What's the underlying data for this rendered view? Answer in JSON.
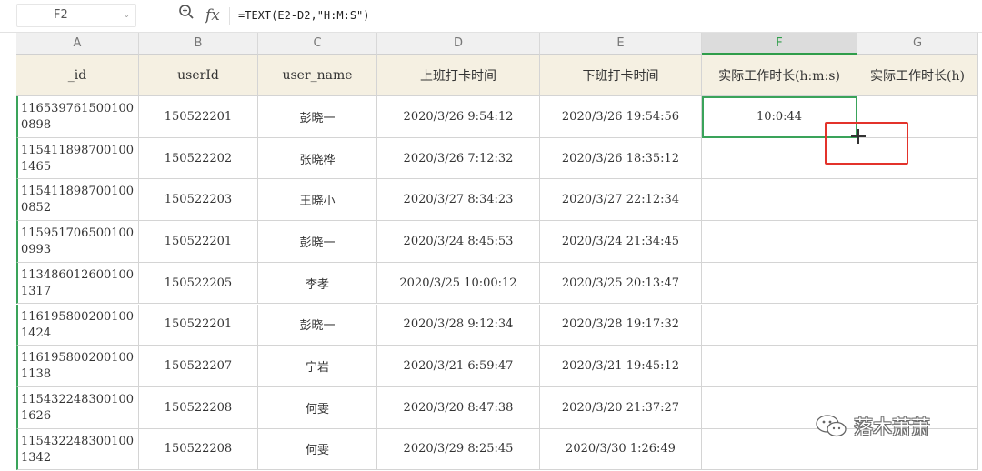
{
  "formula_bar": {
    "cell_ref": "F2",
    "formula": "=TEXT(E2-D2,\"H:M:S\")"
  },
  "columns": [
    "A",
    "B",
    "C",
    "D",
    "E",
    "F",
    "G"
  ],
  "active_column": "F",
  "headers": [
    "_id",
    "userId",
    "user_name",
    "上班打卡时间",
    "下班打卡时间",
    "实际工作时长(h:m:s)",
    "实际工作时长(h)"
  ],
  "rows": [
    [
      "1165397615001000898",
      "150522201",
      "彭晓一",
      "2020/3/26  9:54:12",
      "2020/3/26  19:54:56",
      "10:0:44",
      ""
    ],
    [
      "1154118987001001465",
      "150522202",
      "张晓桦",
      "2020/3/26  7:12:32",
      "2020/3/26  18:35:12",
      "",
      ""
    ],
    [
      "1154118987001000852",
      "150522203",
      "王晓小",
      "2020/3/27  8:34:23",
      "2020/3/27  22:12:34",
      "",
      ""
    ],
    [
      "1159517065001000993",
      "150522201",
      "彭晓一",
      "2020/3/24  8:45:53",
      "2020/3/24  21:34:45",
      "",
      ""
    ],
    [
      "1134860126001001317",
      "150522205",
      "李孝",
      "2020/3/25  10:00:12",
      "2020/3/25  20:13:47",
      "",
      ""
    ],
    [
      "1161958002001001424",
      "150522201",
      "彭晓一",
      "2020/3/28  9:12:34",
      "2020/3/28  19:17:32",
      "",
      ""
    ],
    [
      "1161958002001001138",
      "150522207",
      "宁岩",
      "2020/3/21  6:59:47",
      "2020/3/21  19:45:12",
      "",
      ""
    ],
    [
      "1154322483001001626",
      "150522208",
      "何雯",
      "2020/3/20  8:47:38",
      "2020/3/20  21:37:27",
      "",
      ""
    ],
    [
      "1154322483001001342",
      "150522208",
      "何雯",
      "2020/3/29  8:25:45",
      "2020/3/30  1:26:49",
      "",
      ""
    ]
  ],
  "watermark": {
    "text": "落木萧萧",
    "icon": "wechat-icon"
  }
}
